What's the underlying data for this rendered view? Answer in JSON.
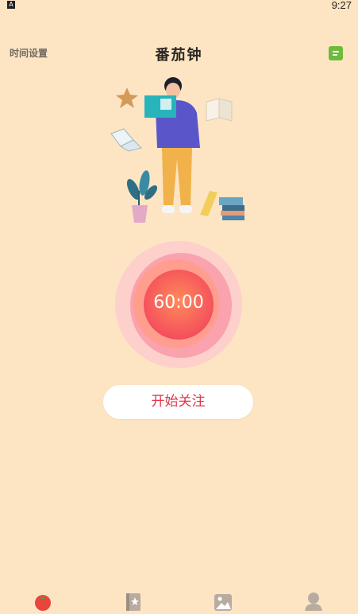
{
  "status_bar": {
    "indicator": "A",
    "time": "9:27"
  },
  "header": {
    "left_label": "时间设置",
    "title": "番茄钟",
    "right_icon": "notes-icon"
  },
  "timer": {
    "display": "60:00"
  },
  "actions": {
    "start_label": "开始关注"
  },
  "tab_bar": {
    "tabs": [
      {
        "icon": "tomato-icon"
      },
      {
        "icon": "star-book-icon"
      },
      {
        "icon": "gallery-icon"
      },
      {
        "icon": "profile-icon"
      }
    ]
  },
  "colors": {
    "background": "#fde5c3",
    "accent": "#e0354a",
    "notes_green": "#6dbb3a"
  }
}
